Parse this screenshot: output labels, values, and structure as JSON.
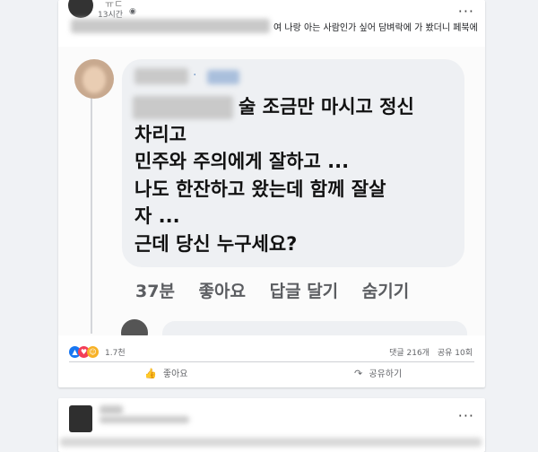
{
  "post1": {
    "author": "ㅠㄷ",
    "time": "13시간",
    "globe_icon": "◉",
    "more_icon": "···",
    "text_visible": "여 나랑 아는 사람인가 싶어 담벼락에 가 봤더니 페북에"
  },
  "comment": {
    "bubble_dot": "·",
    "lines": [
      "술 조금만 마시고 정신",
      "차리고",
      "민주와 주의에게 잘하고 ...",
      " 나도 한잔하고 왔는데 함께 잘살",
      "자 ...",
      "근데 당신 누구세요?"
    ],
    "time": "37분",
    "like": "좋아요",
    "reply": "답글 달기",
    "hide": "숨기기"
  },
  "stats": {
    "reaction_count": "1.7천",
    "comments": "댓글 216개",
    "shares": "공유 10회"
  },
  "buttons": {
    "like_icon": "👍",
    "like": "좋아요",
    "share_icon": "↷",
    "share": "공유하기"
  },
  "post2": {
    "more_icon": "···"
  },
  "colors": {
    "accent": "#1877f2",
    "background": "#f0f2f5"
  }
}
